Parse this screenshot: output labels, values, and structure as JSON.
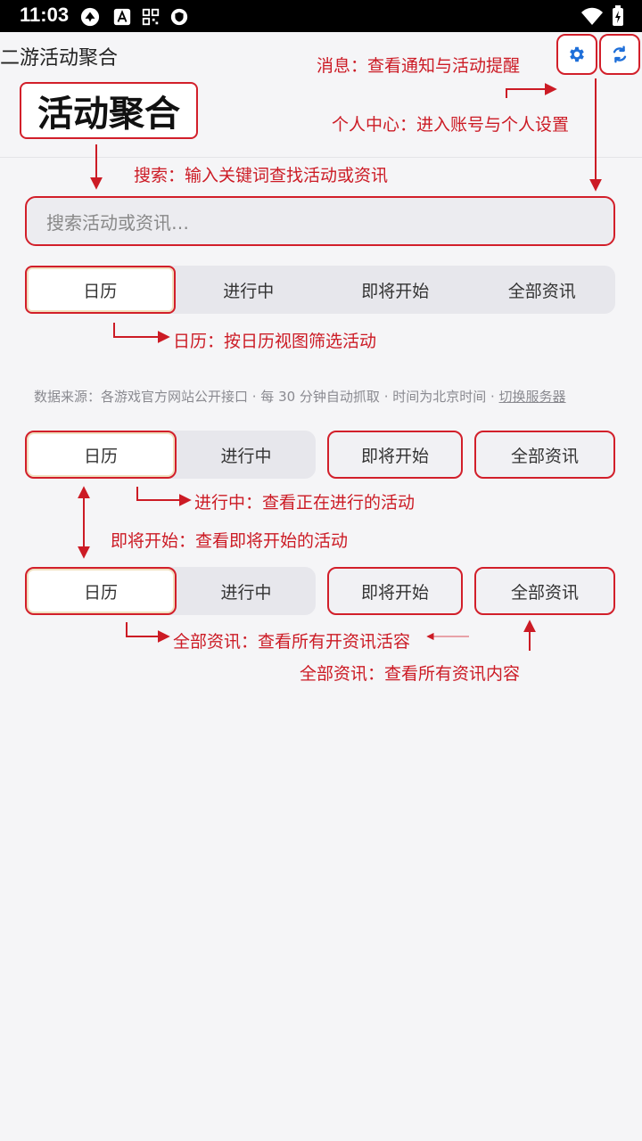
{
  "status_bar": {
    "time": "11:03"
  },
  "app_bar": {
    "title": "二游活动聚合"
  },
  "big_title": "活动聚合",
  "annotations": {
    "messages": "消息：查看通知与活动提醒",
    "profile": "个人中心：进入账号与个人设置",
    "search": "搜索：输入关键词查找活动或资讯",
    "calendar": "日历：按日历视图筛选活动",
    "ongoing": "进行中：查看正在进行的活动",
    "upcoming": "即将开始：查看即将开始的活动",
    "all_news_open": "全部资讯：查看所有开资讯活容",
    "all_news": "全部资讯：查看所有资讯内容"
  },
  "search": {
    "placeholder": "搜索活动或资讯…"
  },
  "tabs": [
    "日历",
    "进行中",
    "即将开始",
    "全部资讯"
  ],
  "source": {
    "text": "数据来源：各游戏官方网站公开接口 · 每 30 分钟自动抓取 · 时间为北京时间 · ",
    "link": "切换服务器"
  },
  "colors": {
    "accent": "#d21f2a",
    "icon_blue": "#1e6fd9",
    "background": "#f5f5f7"
  },
  "icons": [
    "settings-icon",
    "refresh-icon"
  ]
}
